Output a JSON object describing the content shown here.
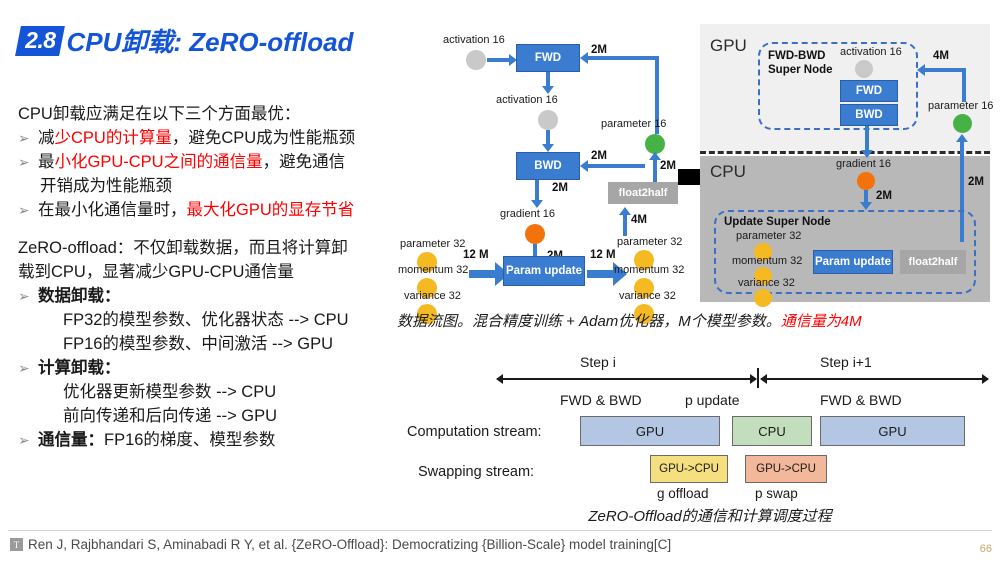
{
  "title": {
    "badge": "2.8",
    "text": "CPU卸载: ZeRO-offload"
  },
  "left_text": {
    "heading": "CPU卸载应满足在以下三个方面最优：",
    "bullet1_a": "减",
    "bullet1_red": "少CPU的计算量",
    "bullet1_b": "，避免CPU成为性能瓶颈",
    "bullet2_a": "最",
    "bullet2_red": "小化GPU-CPU之间的通信量",
    "bullet2_b": "，避免通信",
    "bullet2_cont": "开销成为性能瓶颈",
    "bullet3_a": "在最小化通信量时，",
    "bullet3_red": "最大化GPU的显存节省",
    "para2_l1": "ZeRO-offload：不仅卸载数据，而且将计算卸",
    "para2_l2": "载到CPU，显著减少GPU-CPU通信量",
    "sec1_title": "数据卸载：",
    "sec1_l1": "FP32的模型参数、优化器状态 --> CPU",
    "sec1_l2": "FP16的模型参数、中间激活 --> GPU",
    "sec2_title": "计算卸载：",
    "sec2_l1": "优化器更新模型参数 --> CPU",
    "sec2_l2": "前向传递和后向传递 --> GPU",
    "sec3_title": "通信量：",
    "sec3_rest": "FP16的梯度、模型参数",
    "bullet_marker": "➢"
  },
  "dataflow": {
    "activation_top": "activation 16",
    "fwd": "FWD",
    "activation_mid": "activation 16",
    "bwd": "BWD",
    "gradient": "gradient 16",
    "parameter16": "parameter 16",
    "float2half": "float2half",
    "param_update": "Param update",
    "left_parameter32": "parameter 32",
    "left_momentum32": "momentum 32",
    "left_variance32": "variance 32",
    "right_parameter32": "parameter 32",
    "right_momentum32": "momentum 32",
    "right_variance32": "variance 32",
    "tag_2m_fwd": "2M",
    "tag_2m_bwd": "2M",
    "tag_2m_grad": "2M",
    "tag_2m_f2h": "2M",
    "tag_4m": "4M",
    "tag_12m_left": "12 M",
    "tag_12m_right": "12 M"
  },
  "panel": {
    "gpu_label": "GPU",
    "cpu_label": "CPU",
    "super_node_l1": "FWD-BWD",
    "super_node_l2": "Super Node",
    "activation": "activation 16",
    "fwd": "FWD",
    "bwd": "BWD",
    "parameter16": "parameter 16",
    "gradient": "gradient 16",
    "update_super_node": "Update Super Node",
    "parameter32": "parameter 32",
    "momentum32": "momentum 32",
    "variance32": "variance 32",
    "param_update": "Param update",
    "float2half": "float2half",
    "tag_4m": "4M",
    "tag_2m_grad": "2M",
    "tag_2m_right": "2M"
  },
  "caption": {
    "main": "数据流图。混合精度训练 + Adam优化器，M个模型参数。",
    "red": "通信量为4M"
  },
  "schedule": {
    "step_i": "Step i",
    "step_i1": "Step i+1",
    "phase1": "FWD & BWD",
    "phase2": "p update",
    "phase3": "FWD & BWD",
    "row1_label": "Computation stream:",
    "row2_label": "Swapping stream:",
    "blk_gpu1": "GPU",
    "blk_cpu": "CPU",
    "blk_gpu2": "GPU",
    "swap1": "GPU->CPU",
    "swap2": "GPU->CPU",
    "swap1_label": "g offload",
    "swap2_label": "p swap",
    "caption": "ZeRO-Offload的通信和计算调度过程"
  },
  "footer": {
    "icon": "T",
    "citation": "Ren J, Rajbhandari S, Aminabadi R Y, et al. {ZeRO-Offload}: Democratizing {Billion-Scale} model training[C]",
    "page": "66"
  },
  "colors": {
    "accent_blue": "#1355d6",
    "box_blue": "#3a7cd0",
    "red": "#ff0000",
    "green": "#46b246",
    "orange": "#f2720c",
    "gold": "#f5b921",
    "gray_circle": "#c9c9c9",
    "gpu_bg": "#f0f0f0",
    "cpu_bg": "#b8b8b8"
  }
}
